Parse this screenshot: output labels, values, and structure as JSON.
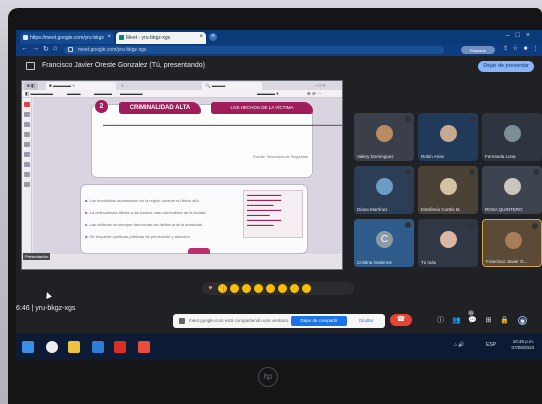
{
  "browser": {
    "tabs": [
      {
        "label": "https://meet.google.com/yru-bkgx"
      },
      {
        "label": "Meet - yru-bkgz-xgs"
      }
    ],
    "address": "meet.google.com/yru-bkgz-xgs",
    "profile_label": "Pausado"
  },
  "meet": {
    "presenting_title": "Francisco Javier Oreste Gonzalez (Tú, presentando)",
    "stop_presenting_label": "Dejar de presentar",
    "meeting_code": "6:46  |  yru-bkgz-xgs",
    "share_notice": "meet.google.com está compartiendo una ventana.",
    "stop_sharing_label": "Dejar de compartir",
    "hide_label": "Ocultar",
    "participants_badge": "11"
  },
  "presentation": {
    "step_number": "2",
    "banner_primary": "CRIMINALIDAD ALTA",
    "banner_secondary": "LOS HECHOS DE LA VÍCTIMA",
    "top_card_note": "Fuente: Secretaría de Seguridad",
    "bullets": [
      {
        "letter": "a.",
        "text": "Los homicidios aumentaron en la región durante el último año."
      },
      {
        "letter": "b.",
        "text": "La delincuencia afecta a los barrios más vulnerables de la ciudad."
      },
      {
        "letter": "c.",
        "text": "Las víctimas no siempre denuncian los delitos ante la autoridad."
      },
      {
        "letter": "d.",
        "text": "Se requieren políticas públicas de prevención y atención."
      }
    ],
    "status_badge": "Presentación"
  },
  "participants": [
    {
      "name": "Valery Domínguez",
      "avatar_color": "#b88b63"
    },
    {
      "name": "Robin Arias",
      "avatar_color": "#c8a891"
    },
    {
      "name": "Fernanda Luna",
      "avatar_color": "#7c8d95"
    },
    {
      "name": "Diana Martínez",
      "avatar_color": "#6b9cc5"
    },
    {
      "name": "Estefanía Cortés M.",
      "avatar_color": "#d3c2a1"
    },
    {
      "name": "ROSA QUINTERO",
      "avatar_color": "#c9c4be"
    },
    {
      "name": "Cristina Gutierrez",
      "avatar_color": "#8e9ba6",
      "letter": "C"
    },
    {
      "name": "Tú más",
      "avatar_color": "#d9b7a5"
    },
    {
      "name": "Francisco Javier O...",
      "avatar_color": "#a87d5a"
    }
  ],
  "taskbar": {
    "time": "10:46 p.m.",
    "date": "07/08/2023",
    "lang": "ESP"
  },
  "device_logo": "hp"
}
